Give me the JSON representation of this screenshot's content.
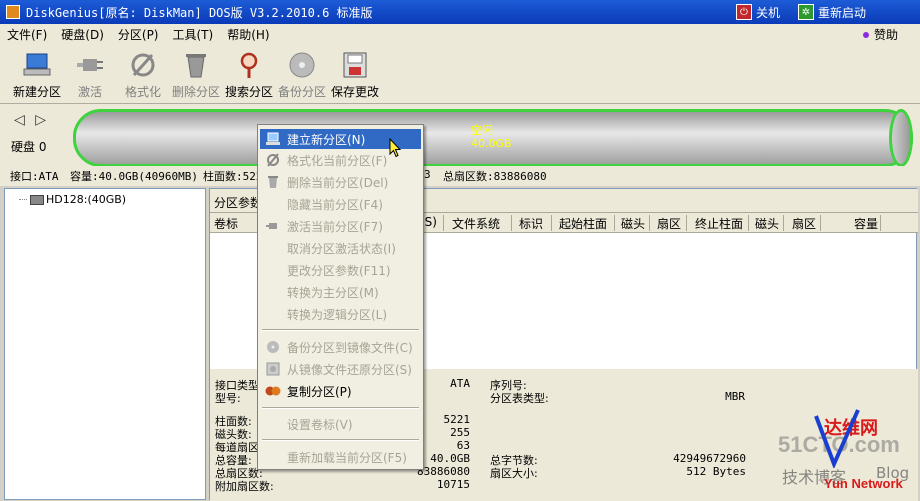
{
  "window": {
    "title": "DiskGenius[原名: DiskMan] DOS版 V3.2.2010.6 标准版",
    "shutdown_label": "关机",
    "restart_label": "重新启动"
  },
  "menubar": {
    "items": [
      "文件(F)",
      "硬盘(D)",
      "分区(P)",
      "工具(T)",
      "帮助(H)"
    ],
    "sponsor_label": "赞助"
  },
  "toolbar": {
    "items": [
      {
        "label": "新建分区",
        "icon": "new-partition-icon",
        "enabled": true
      },
      {
        "label": "激活",
        "icon": "plug-icon",
        "enabled": false
      },
      {
        "label": "格式化",
        "icon": "format-icon",
        "enabled": false
      },
      {
        "label": "删除分区",
        "icon": "trash-icon",
        "enabled": false
      },
      {
        "label": "搜索分区",
        "icon": "magnifier-icon",
        "enabled": true
      },
      {
        "label": "备份分区",
        "icon": "disc-icon",
        "enabled": false
      },
      {
        "label": "保存更改",
        "icon": "save-icon",
        "enabled": true
      }
    ]
  },
  "diskbar": {
    "disk_label": "硬盘 0",
    "free_label": "空闲",
    "free_size": "40.0GB"
  },
  "infoline": {
    "interface": "接口:ATA",
    "capacity": "容量:40.0GB(40960MB)",
    "cylinders_prefix": "柱面数:522",
    "sectors_frag": "3",
    "total_sectors": "总扇区数:83886080"
  },
  "tree": {
    "disk_node": "HD128:(40GB)"
  },
  "panel": {
    "tab_label": "分区参数",
    "columns": [
      "卷标",
      "(S)",
      "文件系统",
      "标识",
      "起始柱面",
      "磁头",
      "扇区",
      "终止柱面",
      "磁头",
      "扇区",
      "容量"
    ]
  },
  "details": {
    "interface_type_label": "接口类型",
    "interface_type_value": "ATA",
    "model_label": "型号:",
    "serial_label": "序列号:",
    "ptable_type_label": "分区表类型:",
    "ptable_type_value": "MBR",
    "cylinders_label": "柱面数:",
    "cylinders_value": "5221",
    "heads_label": "磁头数:",
    "heads_value": "255",
    "spt_label": "每道扇区",
    "spt_value": "63",
    "total_cap_label": "总容量:",
    "total_cap_value": "40.0GB",
    "total_bytes_label": "总字节数:",
    "total_bytes_value": "42949672960",
    "total_sectors_label": "总扇区数:",
    "total_sectors_value": "83886080",
    "sector_size_label": "扇区大小:",
    "sector_size_value": "512 Bytes",
    "extra_sectors_label": "附加扇区数:",
    "extra_sectors_value": "10715"
  },
  "context_menu": {
    "items": [
      {
        "label": "建立新分区(N)",
        "icon": "new-partition-icon",
        "enabled": true,
        "highlight": true
      },
      {
        "label": "格式化当前分区(F)",
        "icon": "format-icon",
        "enabled": false
      },
      {
        "label": "删除当前分区(Del)",
        "icon": "trash-icon",
        "enabled": false
      },
      {
        "label": "隐藏当前分区(F4)",
        "icon": "",
        "enabled": false
      },
      {
        "label": "激活当前分区(F7)",
        "icon": "plug-icon",
        "enabled": false
      },
      {
        "label": "取消分区激活状态(I)",
        "icon": "",
        "enabled": false
      },
      {
        "label": "更改分区参数(F11)",
        "icon": "",
        "enabled": false
      },
      {
        "label": "转换为主分区(M)",
        "icon": "",
        "enabled": false
      },
      {
        "label": "转换为逻辑分区(L)",
        "icon": "",
        "enabled": false
      },
      {
        "label": "备份分区到镜像文件(C)",
        "icon": "disc-icon",
        "enabled": false
      },
      {
        "label": "从镜像文件还原分区(S)",
        "icon": "restore-icon",
        "enabled": false
      },
      {
        "label": "复制分区(P)",
        "icon": "copy-icon",
        "enabled": true
      },
      {
        "label": "设置卷标(V)",
        "icon": "",
        "enabled": false
      },
      {
        "label": "重新加载当前分区(F5)",
        "icon": "",
        "enabled": false
      }
    ]
  },
  "watermark": {
    "line1": "51CTO.com",
    "line2": "技术博客",
    "line3": "Blog",
    "brand": "达维网",
    "brand_en": "Yun Network"
  },
  "colors": {
    "titlebar": "#0a3ab8",
    "highlight": "#316ac5",
    "disk_border": "#3fd23f",
    "free_text": "#ffff00"
  }
}
